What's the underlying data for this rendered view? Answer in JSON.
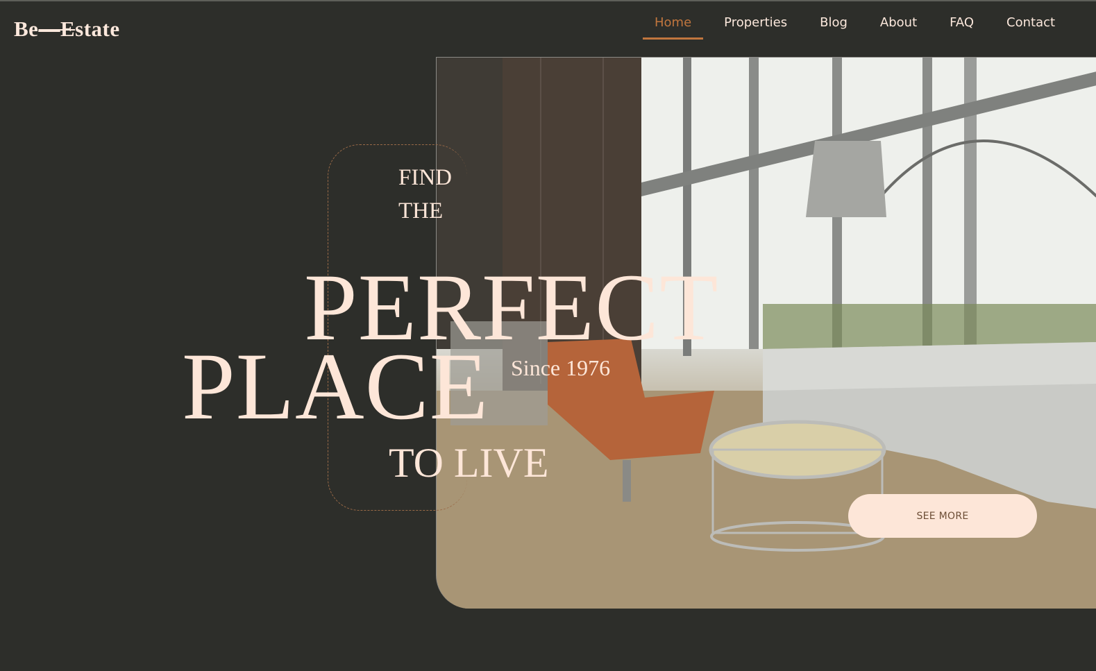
{
  "brand": {
    "name_prefix": "Be",
    "name_strike": "—E",
    "name_suffix": "state"
  },
  "nav": {
    "items": [
      {
        "label": "Home",
        "active": true
      },
      {
        "label": "Properties",
        "active": false
      },
      {
        "label": "Blog",
        "active": false
      },
      {
        "label": "About",
        "active": false
      },
      {
        "label": "FAQ",
        "active": false
      },
      {
        "label": "Contact",
        "active": false
      }
    ]
  },
  "hero": {
    "line1": "FIND",
    "line2": "THE",
    "line3": "PERFECT",
    "line4": "PLACE",
    "since": "Since 1976",
    "line5": "TO LIVE",
    "cta_label": "SEE MORE",
    "image_subject": "modern-living-room-photo"
  },
  "colors": {
    "background": "#2d2e2a",
    "accent": "#c1763e",
    "text_cream": "#fde6d8"
  }
}
